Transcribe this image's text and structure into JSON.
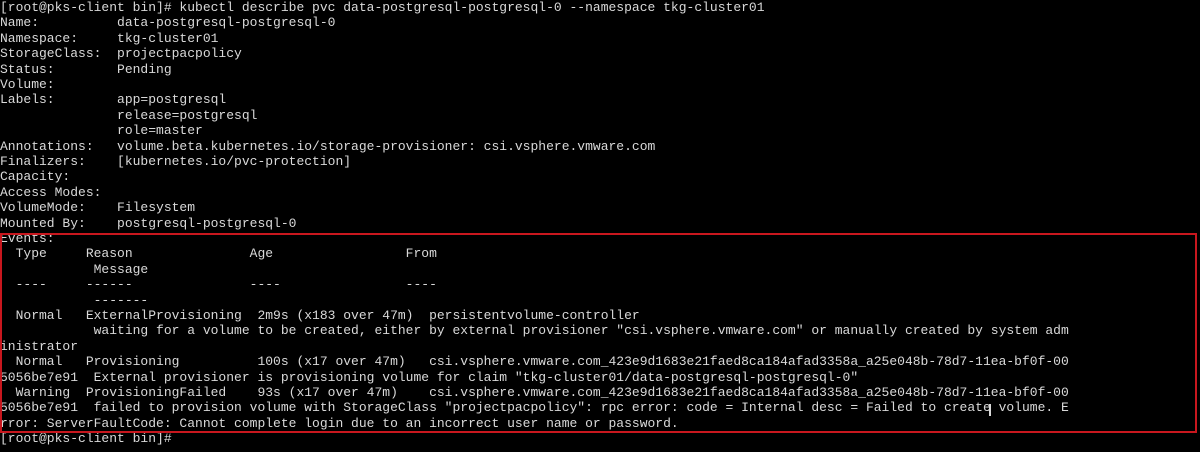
{
  "prompt_text": "[root@pks-client bin]# ",
  "command": "kubectl describe pvc data-postgresql-postgresql-0 --namespace tkg-cluster01",
  "lines": [
    "[root@pks-client bin]# kubectl describe pvc data-postgresql-postgresql-0 --namespace tkg-cluster01",
    "Name:          data-postgresql-postgresql-0",
    "Namespace:     tkg-cluster01",
    "StorageClass:  projectpacpolicy",
    "Status:        Pending",
    "Volume:",
    "Labels:        app=postgresql",
    "               release=postgresql",
    "               role=master",
    "Annotations:   volume.beta.kubernetes.io/storage-provisioner: csi.vsphere.vmware.com",
    "Finalizers:    [kubernetes.io/pvc-protection]",
    "Capacity:",
    "Access Modes:",
    "VolumeMode:    Filesystem",
    "Mounted By:    postgresql-postgresql-0",
    "Events:",
    "  Type     Reason               Age                 From",
    "            Message",
    "  ----     ------               ----                ----",
    "            -------",
    "  Normal   ExternalProvisioning  2m9s (x183 over 47m)  persistentvolume-controller",
    "            waiting for a volume to be created, either by external provisioner \"csi.vsphere.vmware.com\" or manually created by system adm",
    "inistrator",
    "  Normal   Provisioning          100s (x17 over 47m)   csi.vsphere.vmware.com_423e9d1683e21faed8ca184afad3358a_a25e048b-78d7-11ea-bf0f-00",
    "5056be7e91  External provisioner is provisioning volume for claim \"tkg-cluster01/data-postgresql-postgresql-0\"",
    "  Warning  ProvisioningFailed    93s (x17 over 47m)    csi.vsphere.vmware.com_423e9d1683e21faed8ca184afad3358a_a25e048b-78d7-11ea-bf0f-00",
    "5056be7e91  failed to provision volume with StorageClass \"projectpacpolicy\": rpc error: code = Internal desc = Failed to create volume. E",
    "rror: ServerFaultCode: Cannot complete login due to an incorrect user name or password.",
    "[root@pks-client bin]#"
  ],
  "colors": {
    "background": "#000000",
    "foreground": "#d9d9d9",
    "highlight_border": "#c8171e"
  }
}
